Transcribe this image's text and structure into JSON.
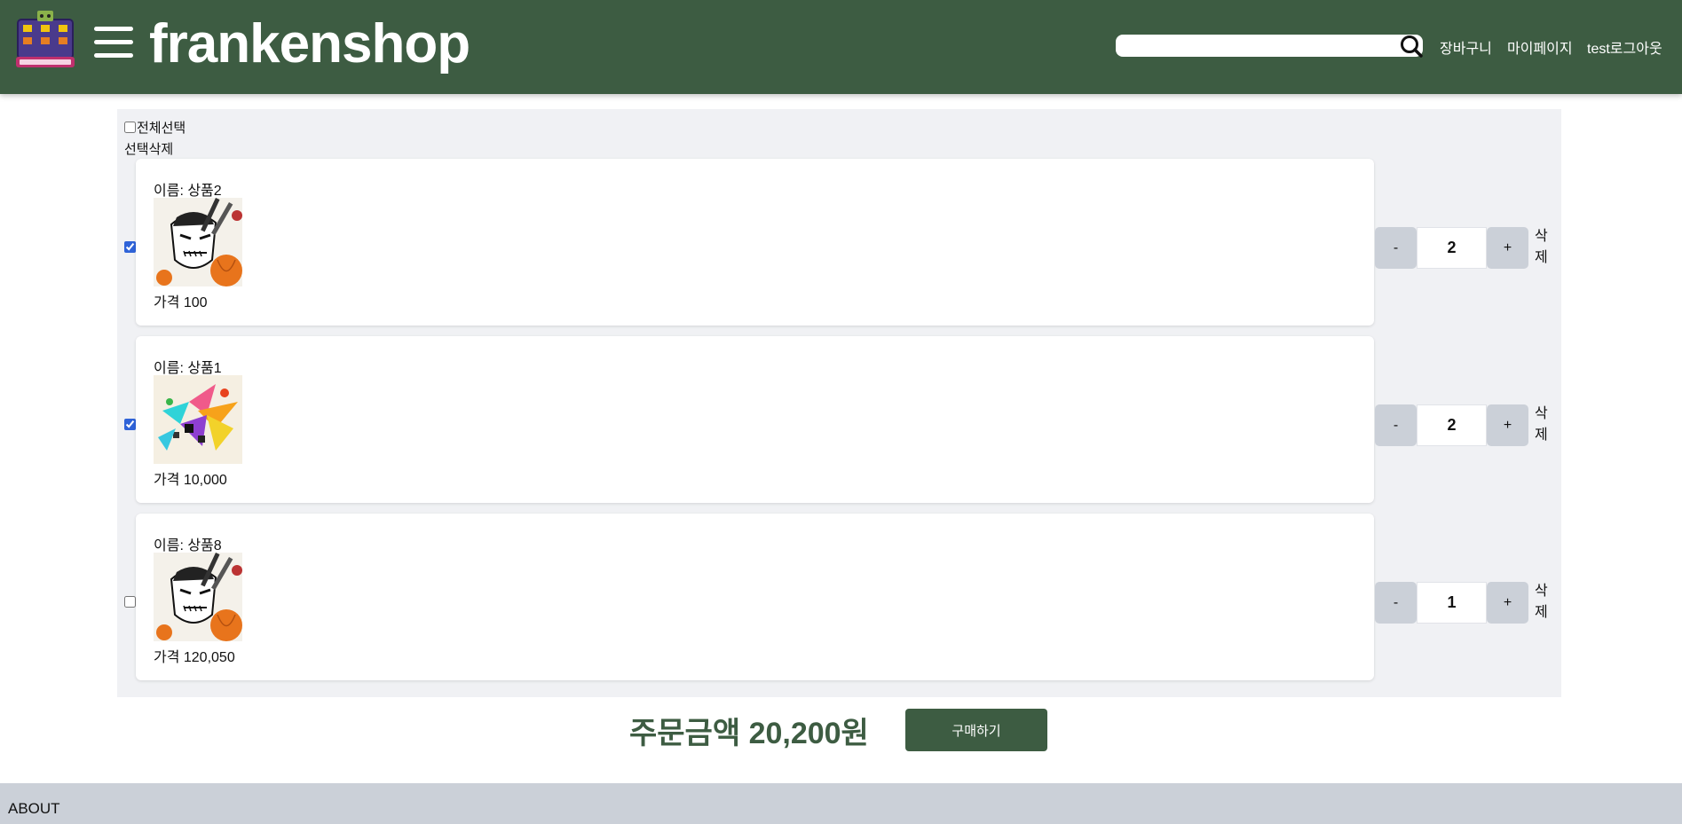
{
  "header": {
    "logo_icon": "frankenshop-castle-logo",
    "brand": "frankenshop",
    "search": {
      "value": "",
      "placeholder": ""
    },
    "nav": {
      "cart": "장바구니",
      "mypage": "마이페이지",
      "logout": "test로그아웃"
    }
  },
  "cart": {
    "select_all_label": "전체선택",
    "select_all_checked": false,
    "delete_selected_label": "선택삭제",
    "items": [
      {
        "name": "이름: 상품2",
        "price": "가격 100",
        "qty": "2",
        "checked": true,
        "image": "frankenstein-halloween-illustration",
        "minus": "-",
        "plus": "+",
        "delete": "삭제"
      },
      {
        "name": "이름: 상품1",
        "price": "가격 10,000",
        "qty": "2",
        "checked": true,
        "image": "colorful-paint-splash-abstract",
        "minus": "-",
        "plus": "+",
        "delete": "삭제"
      },
      {
        "name": "이름: 상품8",
        "price": "가격 120,050",
        "qty": "1",
        "checked": false,
        "image": "frankenstein-halloween-illustration",
        "minus": "-",
        "plus": "+",
        "delete": "삭제"
      }
    ],
    "total_label": "주문금액 20,200원",
    "buy_label": "구매하기"
  },
  "footer": {
    "about": "ABOUT"
  },
  "colors": {
    "header_bg": "#3d5c42",
    "panel_bg": "#f0f1f4",
    "footer_bg": "#cbd0d8",
    "accent": "#3d5c42"
  }
}
